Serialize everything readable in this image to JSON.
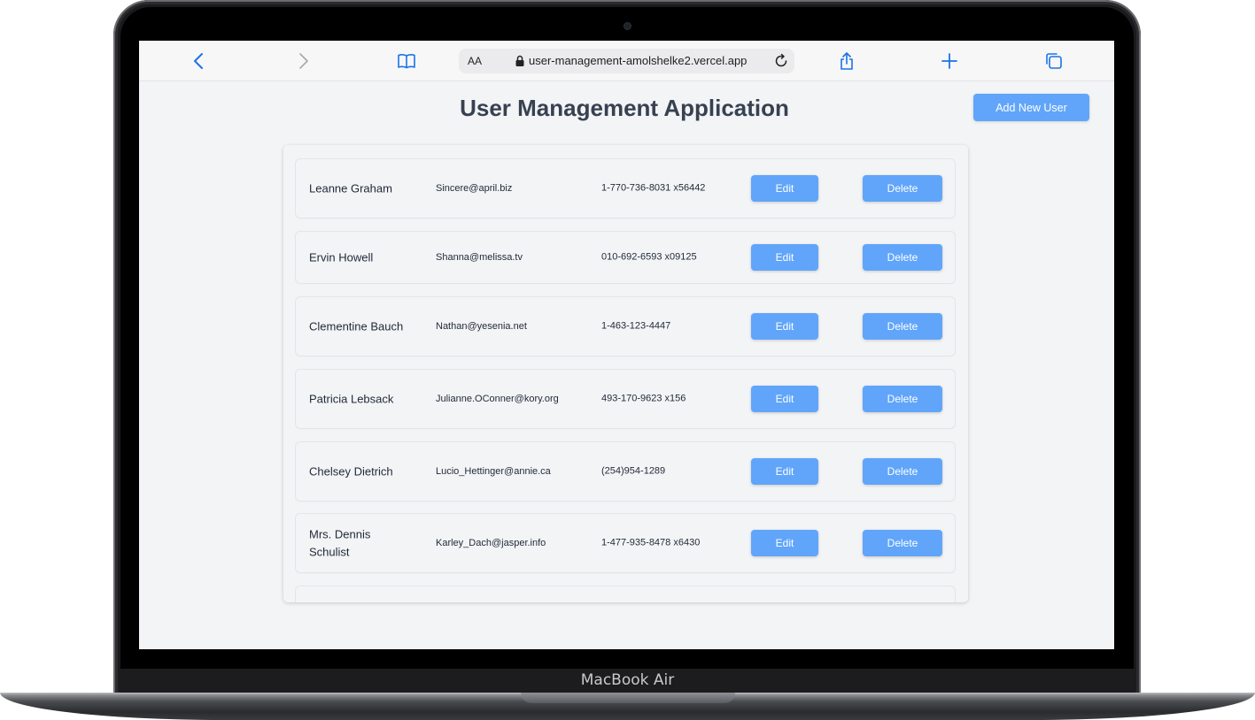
{
  "device": {
    "label": "MacBook Air"
  },
  "browser": {
    "text_size_label": "AA",
    "url": "user-management-amolshelke2.vercel.app",
    "icons": [
      "back-icon",
      "forward-icon",
      "bookmarks-icon",
      "lock-icon",
      "reload-icon",
      "share-icon",
      "new-tab-icon",
      "tabs-icon"
    ]
  },
  "page": {
    "title": "User Management Application",
    "add_button": "Add New User"
  },
  "users": [
    {
      "name": "Leanne Graham",
      "email": "Sincere@april.biz",
      "phone": "1-770-736-8031 x56442",
      "edit": "Edit",
      "delete": "Delete"
    },
    {
      "name": "Ervin Howell",
      "email": "Shanna@melissa.tv",
      "phone": "010-692-6593 x09125",
      "edit": "Edit",
      "delete": "Delete"
    },
    {
      "name": "Clementine Bauch",
      "email": "Nathan@yesenia.net",
      "phone": "1-463-123-4447",
      "edit": "Edit",
      "delete": "Delete"
    },
    {
      "name": "Patricia Lebsack",
      "email": "Julianne.OConner@kory.org",
      "phone": "493-170-9623 x156",
      "edit": "Edit",
      "delete": "Delete"
    },
    {
      "name": "Chelsey Dietrich",
      "email": "Lucio_Hettinger@annie.ca",
      "phone": "(254)954-1289",
      "edit": "Edit",
      "delete": "Delete"
    },
    {
      "name": "Mrs. Dennis Schulist",
      "email": "Karley_Dach@jasper.info",
      "phone": "1-477-935-8478 x6430",
      "edit": "Edit",
      "delete": "Delete"
    }
  ],
  "colors": {
    "accent": "#60a5fa",
    "page_background": "#f3f4f6",
    "title_text": "#374151",
    "browser_icon": "#1a73e8"
  }
}
